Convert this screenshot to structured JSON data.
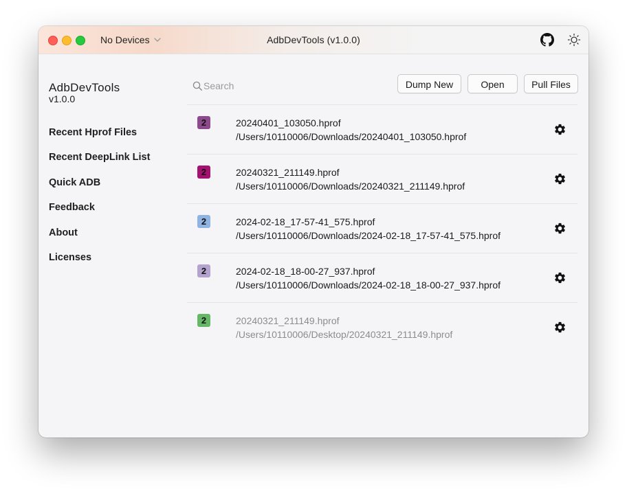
{
  "titlebar": {
    "device_select": "No Devices",
    "title": "AdbDevTools (v1.0.0)",
    "icons": [
      "github-icon",
      "theme-toggle-sun-icon"
    ]
  },
  "sidebar": {
    "app_name": "AdbDevTools",
    "app_version": "v1.0.0",
    "items": [
      {
        "label": "Recent Hprof Files"
      },
      {
        "label": "Recent DeepLink List"
      },
      {
        "label": "Quick ADB"
      },
      {
        "label": "Feedback"
      },
      {
        "label": "About"
      },
      {
        "label": "Licenses"
      }
    ]
  },
  "toolbar": {
    "search_placeholder": "Search",
    "dump_new_label": "Dump New",
    "open_label": "Open",
    "pull_files_label": "Pull Files"
  },
  "files": [
    {
      "badge": "2",
      "badge_color": "#8c4a8c",
      "name": "20240401_103050.hprof",
      "path": "/Users/10110006/Downloads/20240401_103050.hprof",
      "dimmed": false
    },
    {
      "badge": "2",
      "badge_color": "#a3126f",
      "name": "20240321_211149.hprof",
      "path": "/Users/10110006/Downloads/20240321_211149.hprof",
      "dimmed": false
    },
    {
      "badge": "2",
      "badge_color": "#8fb4e3",
      "name": "2024-02-18_17-57-41_575.hprof",
      "path": "/Users/10110006/Downloads/2024-02-18_17-57-41_575.hprof",
      "dimmed": false
    },
    {
      "badge": "2",
      "badge_color": "#b5a3cf",
      "name": "2024-02-18_18-00-27_937.hprof",
      "path": "/Users/10110006/Downloads/2024-02-18_18-00-27_937.hprof",
      "dimmed": false
    },
    {
      "badge": "2",
      "badge_color": "#66b866",
      "name": "20240321_211149.hprof",
      "path": "/Users/10110006/Desktop/20240321_211149.hprof",
      "dimmed": true
    }
  ]
}
